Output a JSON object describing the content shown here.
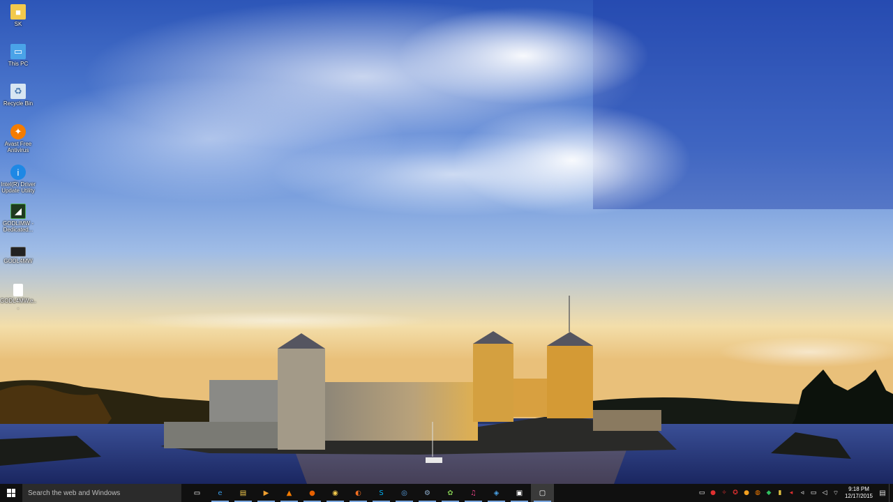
{
  "desktop": {
    "icons": [
      {
        "label": "SK",
        "icon": "user-folder-icon",
        "color": "#f2c94c"
      },
      {
        "label": "This PC",
        "icon": "computer-icon",
        "color": "#4aa3e8"
      },
      {
        "label": "Recycle Bin",
        "icon": "recycle-bin-icon",
        "color": "#d8e6f2"
      },
      {
        "label": "Avast Free Antivirus",
        "icon": "avast-icon",
        "color": "#f57c00"
      },
      {
        "label": "Intel(R) Driver Update Utility",
        "icon": "intel-icon",
        "color": "#1e88e5"
      },
      {
        "label": "GODLIMW - Dedicated...",
        "icon": "game-server-icon",
        "color": "#2e7d32"
      },
      {
        "label": "GODL4MW",
        "icon": "game-icon",
        "color": "#333333"
      },
      {
        "label": "GODL4MW.e...",
        "icon": "file-icon",
        "color": "#ffffff"
      }
    ]
  },
  "taskbar": {
    "search_placeholder": "Search the web and Windows",
    "apps": [
      {
        "name": "task-view",
        "glyph": "▭",
        "color": "#ffffff",
        "bg": "transparent"
      },
      {
        "name": "edge",
        "glyph": "e",
        "color": "#3a96dd",
        "bg": "transparent"
      },
      {
        "name": "file-explorer",
        "glyph": "▤",
        "color": "#f2c94c",
        "bg": "transparent"
      },
      {
        "name": "media-player",
        "glyph": "▶",
        "color": "#f0a030",
        "bg": "transparent"
      },
      {
        "name": "vlc",
        "glyph": "▲",
        "color": "#f57c00",
        "bg": "transparent"
      },
      {
        "name": "firefox",
        "glyph": "●",
        "color": "#e66000",
        "bg": "transparent"
      },
      {
        "name": "chrome",
        "glyph": "◉",
        "color": "#f2c94c",
        "bg": "transparent"
      },
      {
        "name": "origin",
        "glyph": "◐",
        "color": "#f36f21",
        "bg": "transparent"
      },
      {
        "name": "skype",
        "glyph": "S",
        "color": "#00aff0",
        "bg": "transparent"
      },
      {
        "name": "browser-globe",
        "glyph": "◎",
        "color": "#5aa0e0",
        "bg": "transparent"
      },
      {
        "name": "steam",
        "glyph": "⚙",
        "color": "#8fb0d0",
        "bg": "transparent"
      },
      {
        "name": "xbox-app",
        "glyph": "✿",
        "color": "#7cc04e",
        "bg": "transparent"
      },
      {
        "name": "itunes",
        "glyph": "♫",
        "color": "#e04080",
        "bg": "transparent"
      },
      {
        "name": "safari",
        "glyph": "◈",
        "color": "#4aa3e8",
        "bg": "transparent"
      },
      {
        "name": "screen-capture",
        "glyph": "▣",
        "color": "#ffffff",
        "bg": "transparent"
      },
      {
        "name": "open-window",
        "glyph": "▢",
        "color": "#ffffff",
        "bg": "#3a3a3a"
      }
    ],
    "tray_icons": [
      {
        "name": "notes-tray-icon",
        "glyph": "▭",
        "color": "#ffffff"
      },
      {
        "name": "antivirus-tray-icon",
        "glyph": "●",
        "color": "#e03030"
      },
      {
        "name": "network-tray-icon",
        "glyph": "✧",
        "color": "#e03030"
      },
      {
        "name": "game-tray-icon",
        "glyph": "✪",
        "color": "#e03030"
      },
      {
        "name": "alert-tray-icon",
        "glyph": "●",
        "color": "#f2a020"
      },
      {
        "name": "avast-tray-icon",
        "glyph": "◍",
        "color": "#f57c00"
      },
      {
        "name": "update-tray-icon",
        "glyph": "◆",
        "color": "#30c060"
      },
      {
        "name": "power-tray-icon",
        "glyph": "▮",
        "color": "#e0c040"
      },
      {
        "name": "flag-tray-icon",
        "glyph": "◂",
        "color": "#e03030"
      },
      {
        "name": "speaker-tray-icon",
        "glyph": "◃",
        "color": "#ffffff"
      },
      {
        "name": "monitor-tray-icon",
        "glyph": "▭",
        "color": "#ffffff"
      },
      {
        "name": "volume-tray-icon",
        "glyph": "◁",
        "color": "#ffffff"
      },
      {
        "name": "wifi-tray-icon",
        "glyph": "⌔",
        "color": "#ffffff"
      }
    ],
    "clock_time": "9:18 PM",
    "clock_date": "12/17/2015"
  }
}
